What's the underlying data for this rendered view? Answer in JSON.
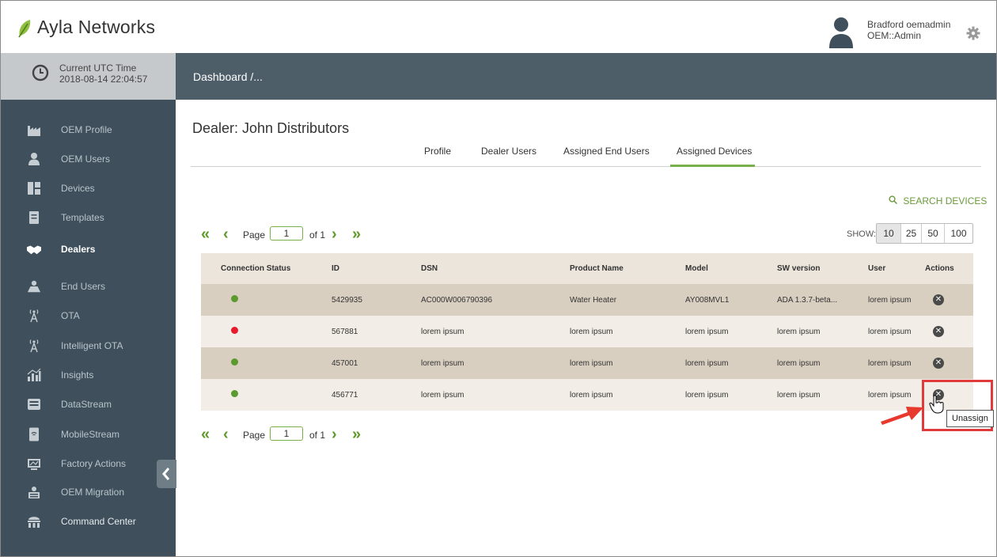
{
  "app": {
    "brand": "Ayla Networks"
  },
  "user": {
    "name": "Bradford oemadmin",
    "role": "OEM::Admin"
  },
  "utc": {
    "label": "Current UTC Time",
    "value": "2018-08-14 22:04:57"
  },
  "breadcrumb": "Dashboard /...",
  "sidebar": {
    "items": [
      {
        "label": "OEM Profile",
        "icon": "factory-icon"
      },
      {
        "label": "OEM Users",
        "icon": "user-badge-icon"
      },
      {
        "label": "Devices",
        "icon": "devices-icon"
      },
      {
        "label": "Templates",
        "icon": "template-icon"
      },
      {
        "label": "Dealers",
        "icon": "handshake-icon"
      },
      {
        "label": "End Users",
        "icon": "end-users-icon"
      },
      {
        "label": "OTA",
        "icon": "antenna-icon"
      },
      {
        "label": "Intelligent OTA",
        "icon": "antenna-icon"
      },
      {
        "label": "Insights",
        "icon": "insights-icon"
      },
      {
        "label": "DataStream",
        "icon": "datastream-icon"
      },
      {
        "label": "MobileStream",
        "icon": "mobile-icon"
      },
      {
        "label": "Factory Actions",
        "icon": "factory-actions-icon"
      },
      {
        "label": "OEM Migration",
        "icon": "migration-icon"
      },
      {
        "label": "Command Center",
        "icon": "command-center-icon"
      }
    ]
  },
  "dealer": {
    "title": "Dealer:  John Distributors"
  },
  "tabs": [
    {
      "label": "Profile"
    },
    {
      "label": "Dealer Users"
    },
    {
      "label": "Assigned End Users"
    },
    {
      "label": "Assigned Devices"
    }
  ],
  "search": {
    "label": "SEARCH DEVICES"
  },
  "pagination": {
    "page_label": "Page",
    "page_value": "1",
    "of_label": "of 1"
  },
  "show": {
    "label": "SHOW:",
    "options": [
      "10",
      "25",
      "50",
      "100"
    ]
  },
  "table": {
    "headers": [
      "Connection Status",
      "ID",
      "DSN",
      "Product Name",
      "Model",
      "SW version",
      "User",
      "Actions"
    ],
    "rows": [
      {
        "status": "online",
        "id": "5429935",
        "dsn": "AC000W006790396",
        "product": "Water Heater",
        "model": "AY008MVL1",
        "sw": "ADA 1.3.7-beta...",
        "user": "lorem ipsum"
      },
      {
        "status": "offline",
        "id": "567881",
        "dsn": "lorem ipsum",
        "product": "lorem ipsum",
        "model": "lorem ipsum",
        "sw": "lorem ipsum",
        "user": "lorem ipsum"
      },
      {
        "status": "online",
        "id": "457001",
        "dsn": "lorem ipsum",
        "product": "lorem ipsum",
        "model": "lorem ipsum",
        "sw": "lorem ipsum",
        "user": "lorem ipsum"
      },
      {
        "status": "online",
        "id": "456771",
        "dsn": "lorem ipsum",
        "product": "lorem ipsum",
        "model": "lorem ipsum",
        "sw": "lorem ipsum",
        "user": "lorem ipsum"
      }
    ]
  },
  "tooltip": {
    "text": "Unassign"
  },
  "colors": {
    "accent": "#7ab04b",
    "online": "#5a9a2e",
    "offline": "#e8192c",
    "sidebar": "#3f505c",
    "highlight": "#e03a3a"
  }
}
